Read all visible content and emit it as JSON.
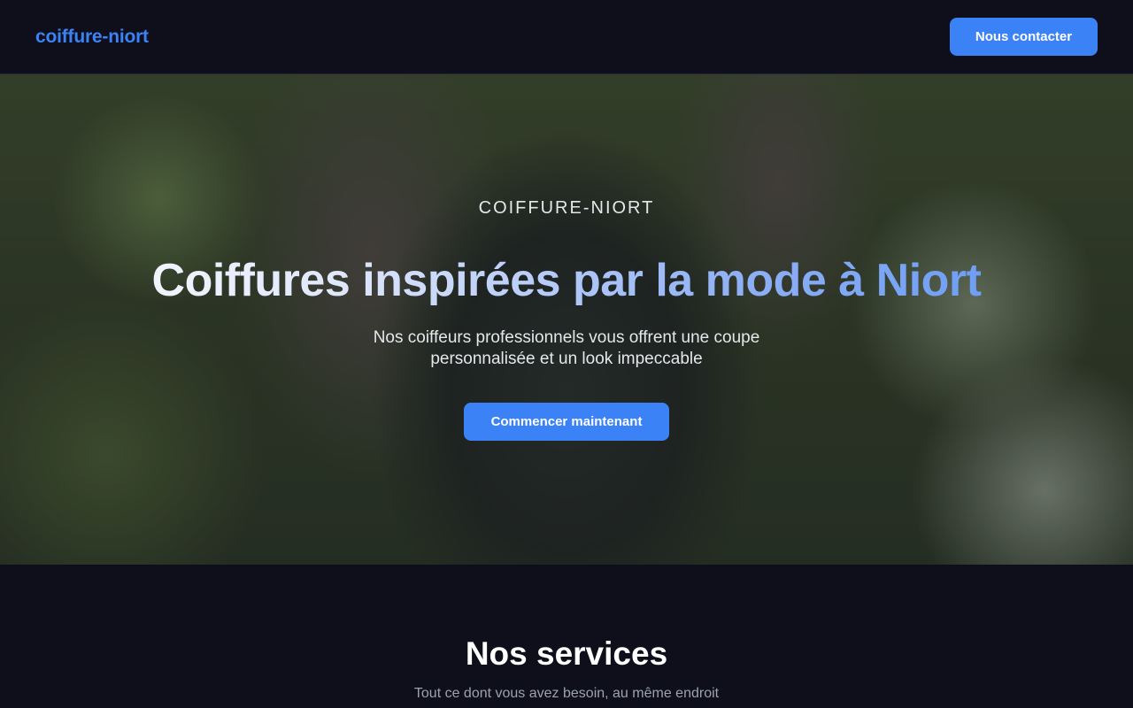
{
  "navbar": {
    "brand": "coiffure-niort",
    "contact_label": "Nous contacter"
  },
  "hero": {
    "eyebrow": "COIFFURE-NIORT",
    "title": "Coiffures inspirées par la mode à Niort",
    "subtitle": "Nos coiffeurs professionnels vous offrent une coupe personnalisée et un look impeccable",
    "cta_label": "Commencer maintenant"
  },
  "services": {
    "title": "Nos services",
    "subtitle": "Tout ce dont vous avez besoin, au même endroit"
  },
  "colors": {
    "accent": "#3b82f6",
    "background": "#0e0f1a"
  }
}
